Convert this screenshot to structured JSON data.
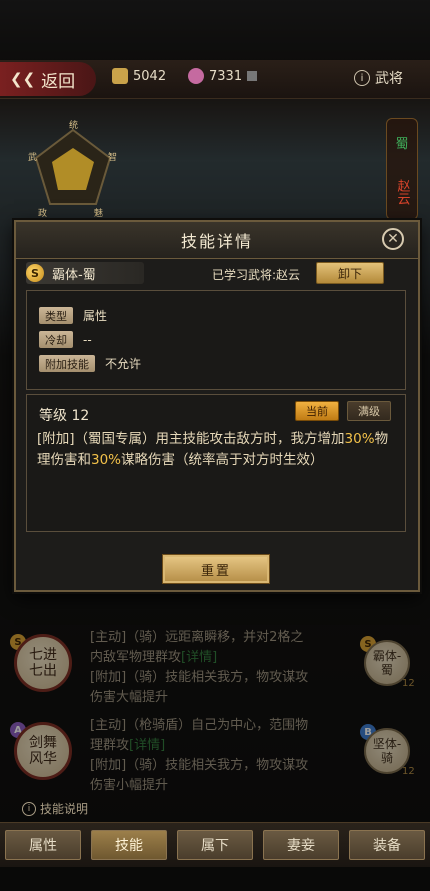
{
  "topbar": {
    "back_label": "返回",
    "resource1_value": "5042",
    "resource2_value": "7331",
    "right_label": "武将"
  },
  "pentagon": {
    "labels": [
      "统",
      "智",
      "魅",
      "政",
      "武"
    ]
  },
  "side": {
    "faction": "蜀",
    "hero_name": "赵云"
  },
  "modal": {
    "title": "技能详情",
    "skill_name": "霸体-蜀",
    "skill_grade": "S",
    "learned_text": "已学习武将:赵云",
    "unequip_label": "卸下",
    "info": [
      {
        "tag": "类型",
        "value": "属性"
      },
      {
        "tag": "冷却",
        "value": "--"
      },
      {
        "tag": "附加技能",
        "value": "不允许"
      }
    ],
    "level_text": "等级 12",
    "current_label": "当前",
    "max_label": "满级",
    "desc_a": "[附加]（蜀国专属）用主技能攻击敌方时，我方增加",
    "desc_hl1": "30%",
    "desc_b": "物理伤害和",
    "desc_hl2": "30%",
    "desc_c": "谋略伤害（统率高于对方时生效）",
    "reset_label": "重置"
  },
  "skills": [
    {
      "grade": "S",
      "medal_line1": "七进",
      "medal_line2": "七出",
      "line1": "[主动]（骑）远距离瞬移，并对2格之",
      "line2a": "内敌军物理群攻",
      "line2b": "[详情]",
      "line3": "[附加]（骑）技能相关我方，物攻谋攻",
      "line4": "伤害大幅提升",
      "side_grade": "S",
      "side_line1": "霸体-",
      "side_line2": "蜀",
      "side_level": "12"
    },
    {
      "grade": "A",
      "medal_line1": "剑舞",
      "medal_line2": "风华",
      "line1": "[主动]（枪骑盾）自己为中心，范围物",
      "line2a": "理群攻",
      "line2b": "[详情]",
      "line3": "[附加]（骑）技能相关我方，物攻谋攻",
      "line4": "伤害小幅提升",
      "side_grade": "B",
      "side_line1": "坚体-",
      "side_line2": "骑",
      "side_level": "12"
    }
  ],
  "skill_help": "技能说明",
  "tabs": [
    "属性",
    "技能",
    "属下",
    "妻妾",
    "装备"
  ],
  "active_tab": "技能",
  "colors": {
    "accent_gold": "#f2c14a",
    "back_red": "#7a2020",
    "green_link": "#2f7a3a"
  }
}
